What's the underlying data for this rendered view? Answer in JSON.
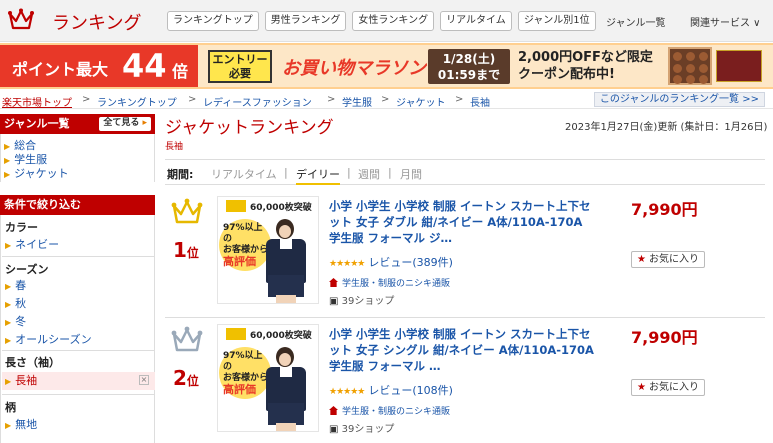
{
  "header": {
    "logo_text": "ランキング",
    "tabs": [
      "ランキングトップ",
      "男性ランキング",
      "女性ランキング",
      "リアルタイム",
      "ジャンル別1位"
    ],
    "genre_list": "ジャンル一覧",
    "related": "関連サービス ∨"
  },
  "banner": {
    "point_text": "ポイント最大",
    "point_value": "44",
    "point_unit": "倍",
    "entry_line1": "エントリー",
    "entry_line2": "必要",
    "event_name": "お買い物マラソン",
    "date_line1": "1/28(土)",
    "date_line2": "01:59まで",
    "coupon_line1": "2,000円OFFなど限定",
    "coupon_line2": "クーポン配布中!"
  },
  "breadcrumb": {
    "items": [
      "楽天市場トップ",
      "ランキングトップ",
      "レディースファッション",
      "学生服",
      "ジャケット",
      "長袖"
    ],
    "right_link": "このジャンルのランキング一覧 >>"
  },
  "sidebar": {
    "genre_title": "ジャンル一覧",
    "show_all": "全て見る",
    "genres": [
      "総合",
      "学生服",
      "ジャケット"
    ],
    "filter_title": "条件で絞り込む",
    "groups": [
      {
        "name": "カラー",
        "items": [
          "ネイビー"
        ]
      },
      {
        "name": "シーズン",
        "items": [
          "春",
          "秋",
          "冬",
          "オールシーズン"
        ]
      },
      {
        "name": "長さ（袖）",
        "items": [
          "長袖"
        ]
      },
      {
        "name": "柄",
        "items": [
          "無地"
        ]
      }
    ],
    "selected_item": "長袖",
    "remove_icon": "×"
  },
  "main": {
    "title": "ジャケットランキング",
    "subtitle": "長袖",
    "updated": "2023年1月27日(金)更新 (集計日：1月26日)",
    "period_label": "期間:",
    "periods": [
      "リアルタイム",
      "デイリー",
      "週間",
      "月間"
    ],
    "active_period": "デイリー"
  },
  "items": [
    {
      "rank": "1",
      "rank_unit": "位",
      "title": "小学 小学生 小学校 制服 イートン スカート上下セット 女子 ダブル 紺/ネイビー A体/110A-170A 学生服 フォーマル ジ…",
      "rating_stars": "★★★★★",
      "review_text": "レビュー(389件)",
      "shop": "学生服・制服のニシキ通販",
      "points": "39ショップ",
      "price": "7,990円",
      "fav": "お気に入り",
      "thumb_badge": "60,000枚突破",
      "thumb_line1": "97%以上の",
      "thumb_line2": "お客様から",
      "thumb_line3": "高評価"
    },
    {
      "rank": "2",
      "rank_unit": "位",
      "title": "小学 小学生 小学校 制服 イートン スカート上下セット 女子 シングル 紺/ネイビー A体/110A-170A 学生服 フォーマル …",
      "rating_stars": "★★★★★",
      "review_text": "レビュー(108件)",
      "shop": "学生服・制服のニシキ通販",
      "points": "39ショップ",
      "price": "7,990円",
      "fav": "お気に入り",
      "thumb_badge": "60,000枚突破",
      "thumb_line1": "97%以上の",
      "thumb_line2": "お客様から",
      "thumb_line3": "高評価"
    }
  ],
  "colors": {
    "brand_red": "#bf0000",
    "link_blue": "#1a55a8",
    "gold_crown": "#e6b800",
    "silver_crown": "#9aa9b9"
  }
}
